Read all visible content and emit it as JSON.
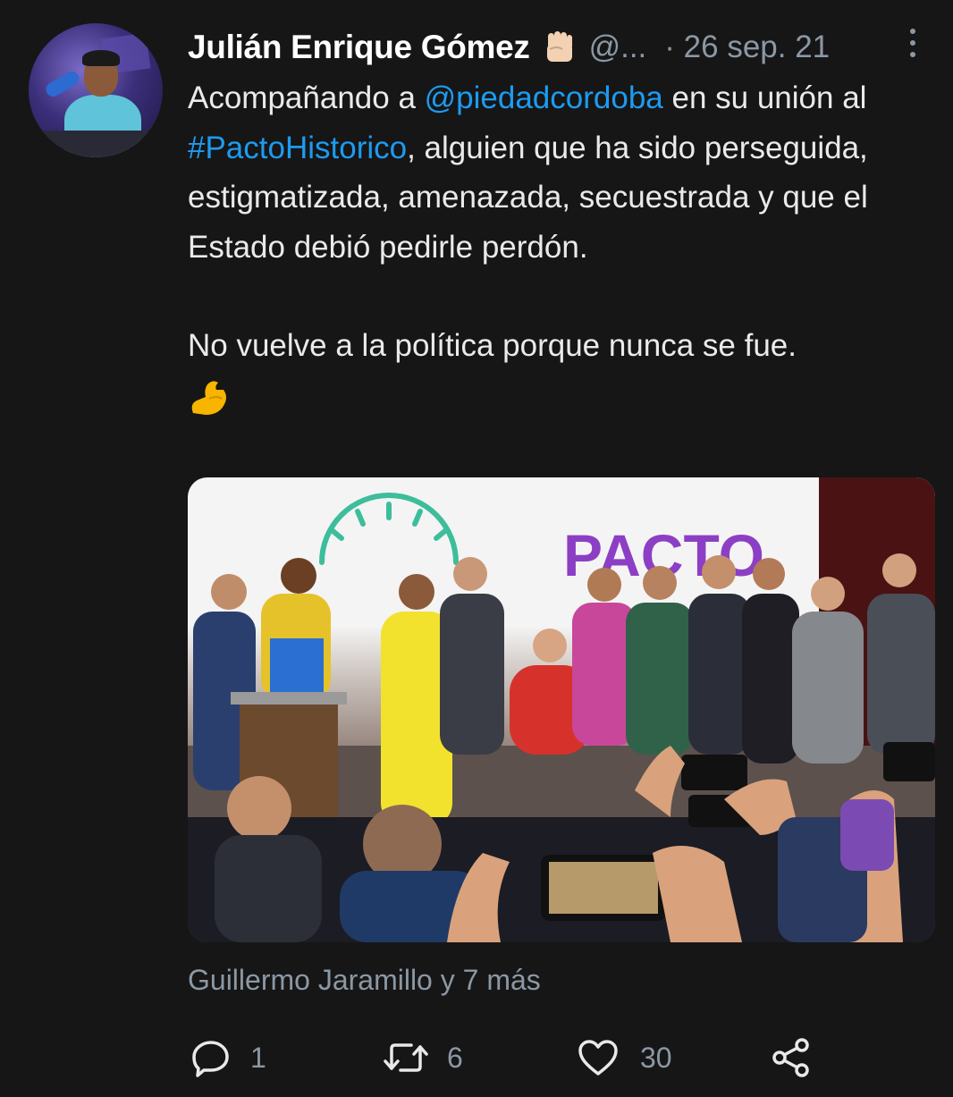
{
  "tweet": {
    "author_name": "Julián Enrique Gómez",
    "author_handle": "@...",
    "date_separator": "·",
    "date": "26 sep. 21",
    "text": {
      "p1_a": "Acompañando a ",
      "mention": "@piedadcordoba",
      "p1_b": " en su unión al ",
      "hashtag": "#PactoHistorico",
      "p1_c": ", alguien que ha sido perseguida, estigmatizada, amenazada, secuestrada y que el Estado debió pedirle perdón.",
      "p2": "No vuelve a la política porque nunca se fue."
    },
    "media": {
      "sign_text": "PACTO"
    },
    "likes_by": "Guillermo Jaramillo y 7 más",
    "actions": {
      "reply_count": "1",
      "retweet_count": "6",
      "like_count": "30"
    }
  },
  "icons": {
    "fist": "raised-fist-emoji",
    "arm": "flexed-biceps-emoji",
    "reply": "reply-icon",
    "retweet": "retweet-icon",
    "like": "heart-icon",
    "share": "share-icon",
    "more": "more-options-icon"
  },
  "colors": {
    "background": "#161616",
    "link": "#1d9bf0",
    "muted": "#8b98a5"
  }
}
